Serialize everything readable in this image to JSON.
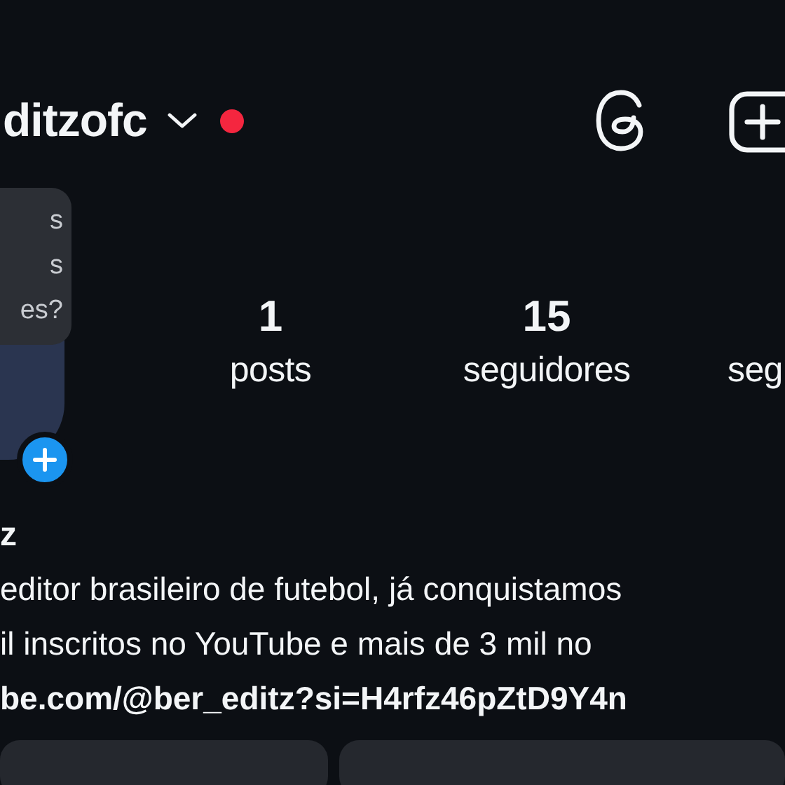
{
  "header": {
    "username": "ditzofc",
    "has_notification": true
  },
  "tooltip": {
    "lines": [
      "s",
      "s",
      "es?"
    ]
  },
  "stats": [
    {
      "value": "1",
      "label": "posts"
    },
    {
      "value": "15",
      "label": "seguidores"
    },
    {
      "label": "seg"
    }
  ],
  "profile": {
    "name": "z",
    "bio": [
      "editor brasileiro de futebol, já conquistamos",
      "il inscritos no YouTube e mais de 3 mil no"
    ],
    "link": "be.com/@ber_editz?si=H4rfz46pZtD9Y4n"
  }
}
